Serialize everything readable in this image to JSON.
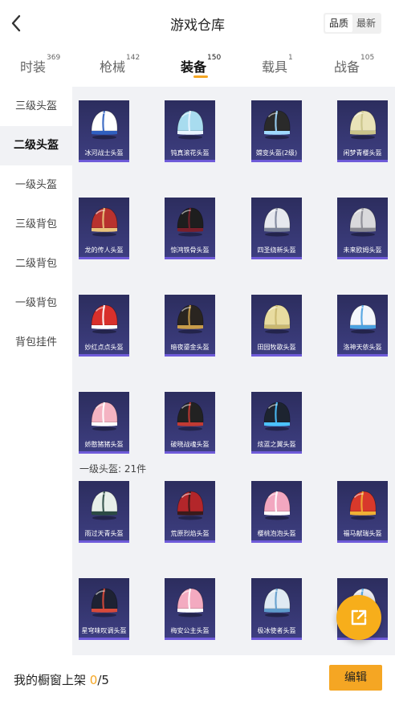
{
  "header": {
    "title": "游戏仓库",
    "sort_options": [
      "品质",
      "最新"
    ],
    "sort_active": "品质"
  },
  "tabs": [
    {
      "label": "时装",
      "count": "369"
    },
    {
      "label": "枪械",
      "count": "142"
    },
    {
      "label": "装备",
      "count": "150",
      "active": true
    },
    {
      "label": "载具",
      "count": "1"
    },
    {
      "label": "战备",
      "count": "105"
    }
  ],
  "sidebar": {
    "items": [
      "三级头盔",
      "二级头盔",
      "一级头盔",
      "三级背包",
      "二级背包",
      "一级背包",
      "背包挂件"
    ],
    "active": "二级头盔"
  },
  "grid": {
    "level2_items": [
      {
        "name": "冰河战士头盔",
        "color": "#ffffff",
        "accent": "#2f5fbf"
      },
      {
        "name": "钝真滚花头盔",
        "color": "#a8dcef",
        "accent": "#e8f4ff"
      },
      {
        "name": "嫦变头盔(2级)",
        "color": "#2a2a2a",
        "accent": "#9fd8ff"
      },
      {
        "name": "闲梦青樱头盔",
        "color": "#e9e3b8",
        "accent": "#c9c38a"
      },
      {
        "name": "龙的传人头盔",
        "color": "#b8322e",
        "accent": "#e9c27a"
      },
      {
        "name": "惊鸿铁骨头盔",
        "color": "#1e1e1e",
        "accent": "#7a1f2b"
      },
      {
        "name": "四圣绕新头盔",
        "color": "#e6e8ee",
        "accent": "#7c8499"
      },
      {
        "name": "未来欧姆头盔",
        "color": "#d9d9dc",
        "accent": "#8a8a92"
      },
      {
        "name": "妙红点点头盔",
        "color": "#d8302c",
        "accent": "#ffffff"
      },
      {
        "name": "暗夜鎏金头盔",
        "color": "#2a2520",
        "accent": "#c99d4a"
      },
      {
        "name": "田园牧歌头盔",
        "color": "#e8dca0",
        "accent": "#c9b870"
      },
      {
        "name": "洛神天依头盔",
        "color": "#f3f6fb",
        "accent": "#4aa1e0"
      },
      {
        "name": "娇憨猪猪头盔",
        "color": "#f4b3c2",
        "accent": "#ffffff"
      },
      {
        "name": "破晓战魂头盔",
        "color": "#222222",
        "accent": "#c23a33"
      },
      {
        "name": "炫蓝之翼头盔",
        "color": "#1d2430",
        "accent": "#4cc2ff"
      }
    ],
    "section_label": "一级头盔: 21件",
    "level1_items": [
      {
        "name": "雨过天青头盔",
        "color": "#e7efe9",
        "accent": "#2b4a44"
      },
      {
        "name": "荒原烈焰头盔",
        "color": "#b3262a",
        "accent": "#3a1a1a"
      },
      {
        "name": "樱桃泡泡头盔",
        "color": "#f2a7c0",
        "accent": "#ffffff"
      },
      {
        "name": "福马献瑞头盔",
        "color": "#d8392b",
        "accent": "#f0b035"
      },
      {
        "name": "星穹味叹调头盔",
        "color": "#1e2233",
        "accent": "#d84a3a"
      },
      {
        "name": "梅安公主头盔",
        "color": "#f3aac0",
        "accent": "#ffffff"
      },
      {
        "name": "极冰使者头盔",
        "color": "#dfeaf3",
        "accent": "#5f9ccc"
      },
      {
        "name": "",
        "color": "#e9e9f0",
        "accent": "#4aa1e0"
      }
    ]
  },
  "bottom": {
    "label": "我的橱窗上架",
    "count_current": "0",
    "count_total": "/5",
    "edit_label": "编辑"
  },
  "icons": {
    "back": "chevron-left-icon",
    "share": "external-link-icon"
  },
  "colors": {
    "accent": "#f5a623",
    "card_bg": "#2c2d5e",
    "card_border": "#6f5bd9"
  }
}
